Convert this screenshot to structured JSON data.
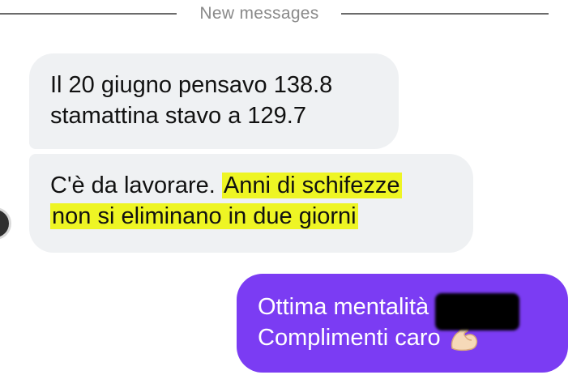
{
  "divider": {
    "label": "New messages"
  },
  "messages": [
    {
      "direction": "incoming",
      "lines": [
        "Il 20 giugno pensavo 138.8",
        "stamattina stavo a 129.7"
      ]
    },
    {
      "direction": "incoming",
      "prefix": "C'è da lavorare. ",
      "highlighted_line1": "Anni di schifezze",
      "highlighted_line2": "non si eliminano in due giorni",
      "highlight_color": "#eef524"
    },
    {
      "direction": "outgoing",
      "line1": "Ottima mentalità",
      "line2": "Complimenti caro",
      "emoji_icon": "flexed-biceps-icon",
      "redacted": true
    }
  ],
  "colors": {
    "incoming_bubble": "#eff1f3",
    "outgoing_bubble": "#7b3cf3",
    "divider_text": "#8a8a8a"
  }
}
